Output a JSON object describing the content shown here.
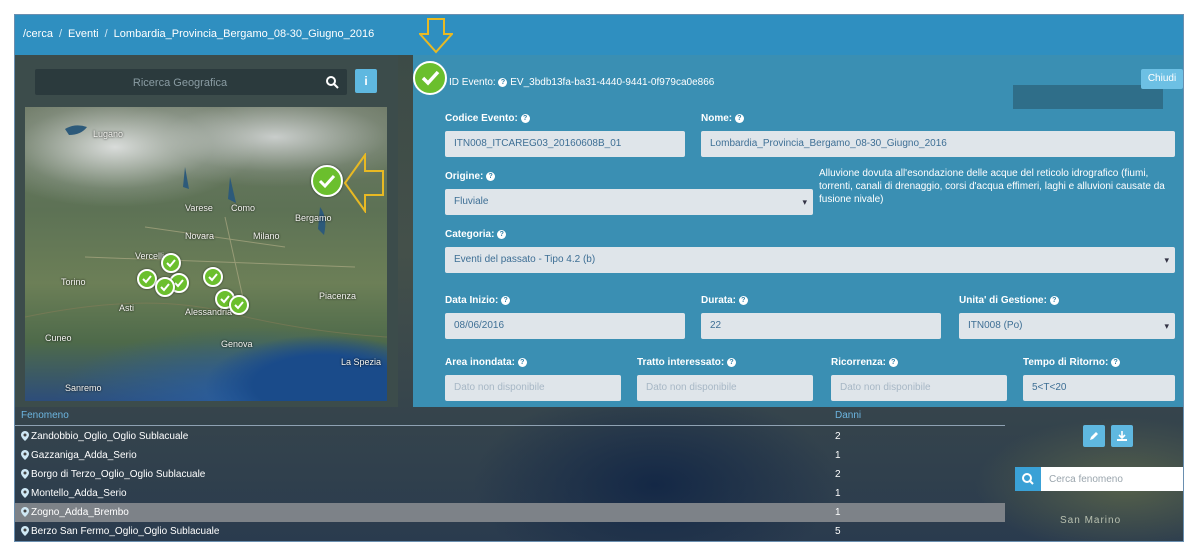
{
  "breadcrumb": [
    "/cerca",
    "Eventi",
    "Lombardia_Provincia_Bergamo_08-30_Giugno_2016"
  ],
  "geo_search": {
    "placeholder": "Ricerca Geografica",
    "info_label": "i"
  },
  "map": {
    "cities": [
      "Lugano",
      "Varese",
      "Como",
      "Bergamo",
      "Milano",
      "Novara",
      "Vercelli",
      "Torino",
      "Asti",
      "Piacenza",
      "Alessandria",
      "Genova",
      "La Spezia",
      "Sanremo",
      "Cuneo"
    ]
  },
  "event": {
    "id_label": "ID Evento:",
    "id_value": "EV_3bdb13fa-ba31-4440-9441-0f979ca0e866",
    "close_label": "Chiudi",
    "codice_label": "Codice Evento:",
    "codice_value": "ITN008_ITCAREG03_20160608B_01",
    "nome_label": "Nome:",
    "nome_value": "Lombardia_Provincia_Bergamo_08-30_Giugno_2016",
    "origine_label": "Origine:",
    "origine_value": "Fluviale",
    "origine_desc": "Alluvione dovuta all'esondazione delle acque del reticolo idrografico (fiumi, torrenti, canali di drenaggio, corsi d'acqua effimeri, laghi e alluvioni causate da fusione nivale)",
    "categoria_label": "Categoria:",
    "categoria_value": "Eventi del passato - Tipo 4.2 (b)",
    "data_inizio_label": "Data Inizio:",
    "data_inizio_value": "08/06/2016",
    "durata_label": "Durata:",
    "durata_value": "22",
    "unita_label": "Unita' di Gestione:",
    "unita_value": "ITN008 (Po)",
    "area_label": "Area inondata:",
    "area_placeholder": "Dato non disponibile",
    "tratto_label": "Tratto interessato:",
    "tratto_placeholder": "Dato non disponibile",
    "ricorrenza_label": "Ricorrenza:",
    "ricorrenza_placeholder": "Dato non disponibile",
    "tempo_label": "Tempo di Ritorno:",
    "tempo_value": "5<T<20"
  },
  "table": {
    "col_fenomeno": "Fenomeno",
    "col_danni": "Danni",
    "rows": [
      {
        "name": "Zandobbio_Oglio_Oglio Sublacuale",
        "danni": "2"
      },
      {
        "name": "Gazzaniga_Adda_Serio",
        "danni": "1"
      },
      {
        "name": "Borgo di Terzo_Oglio_Oglio Sublacuale",
        "danni": "2"
      },
      {
        "name": "Montello_Adda_Serio",
        "danni": "1"
      },
      {
        "name": "Zogno_Adda_Brembo",
        "danni": "1"
      },
      {
        "name": "Berzo San Fermo_Oglio_Oglio Sublacuale",
        "danni": "5"
      }
    ],
    "selected_row": 4
  },
  "search_fenomeno": {
    "placeholder": "Cerca fenomeno"
  },
  "map_background_label": "San Marino",
  "colors": {
    "accent": "#3a8fb3",
    "breadcrumb": "#2f8fc0",
    "pin": "#6bbf2d",
    "arrow": "#e8b923"
  }
}
